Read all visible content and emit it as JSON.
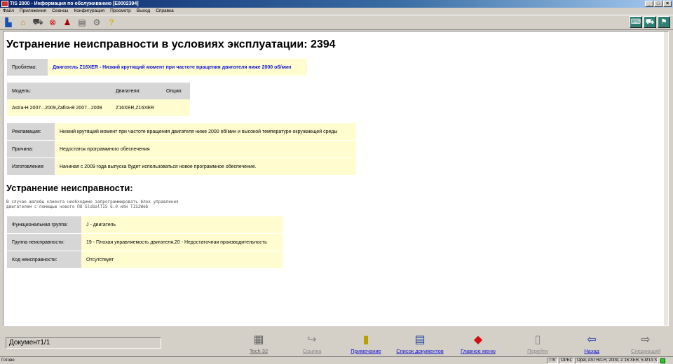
{
  "window": {
    "title": "TIS 2000 - Информация по обслуживанию [E0002394]"
  },
  "menu": [
    "Файл",
    "Приложения",
    "Сеансы",
    "Конфигурация",
    "Просмотр",
    "Выход",
    "Справка"
  ],
  "page": {
    "title": "Устранение неисправности в условиях эксплуатации: 2394",
    "problem_label": "Проблема:",
    "problem_value": "Двигатель Z16XER - Низкий крутящий момент при частоте вращения двигателя ниже 2000 об/мин",
    "table_headers": {
      "model": "Модель:",
      "engines": "Двигатели:",
      "options": "Опции:"
    },
    "table_row": {
      "model": "Astra-H 2007...2009,Zafira-B 2007...2009",
      "engines": "Z16XER,Z16XER",
      "options": ""
    },
    "details": [
      {
        "label": "Рекламация:",
        "value": "Низкий крутящий момент при частоте вращения двигателя ниже 2000 об/мин и высокой температуре окружающей среды"
      },
      {
        "label": "Причина:",
        "value": "Недостаток программного обеспечения"
      },
      {
        "label": "Изготовление:",
        "value": "Начиная с 2009 года выпуска будет использоваться новое программное обеспечение."
      }
    ],
    "section_title": "Устранение неисправности:",
    "instructions_line1": "В случае жалобы клиента необходимо запрограммировать блок управления",
    "instructions_line2": "двигателем с помощью нового ПО GlobalTIS 6.0 или TIS2Web",
    "groups": [
      {
        "label": "Функциональная группа:",
        "value": "J - двигатель"
      },
      {
        "label": "Группа неисправности:",
        "value": "19 - Плохая управляемость двигателя,20 - Недостаточная производительность"
      },
      {
        "label": "Код неисправности:",
        "value": "Отсутствует"
      }
    ]
  },
  "bottom": {
    "document": "Документ1/1",
    "nav": [
      "Tech 32",
      "Ссылка",
      "Примечание",
      "Список документов",
      "Главное меню",
      "Перейти",
      "Назад",
      "Следующий"
    ]
  },
  "status": {
    "ready": "Готово",
    "tis": "TIS",
    "brand": "OPEL",
    "vehicle": "Opel, ASTRA-H, 2009, Z 16 XER, 5-MTA SP"
  }
}
